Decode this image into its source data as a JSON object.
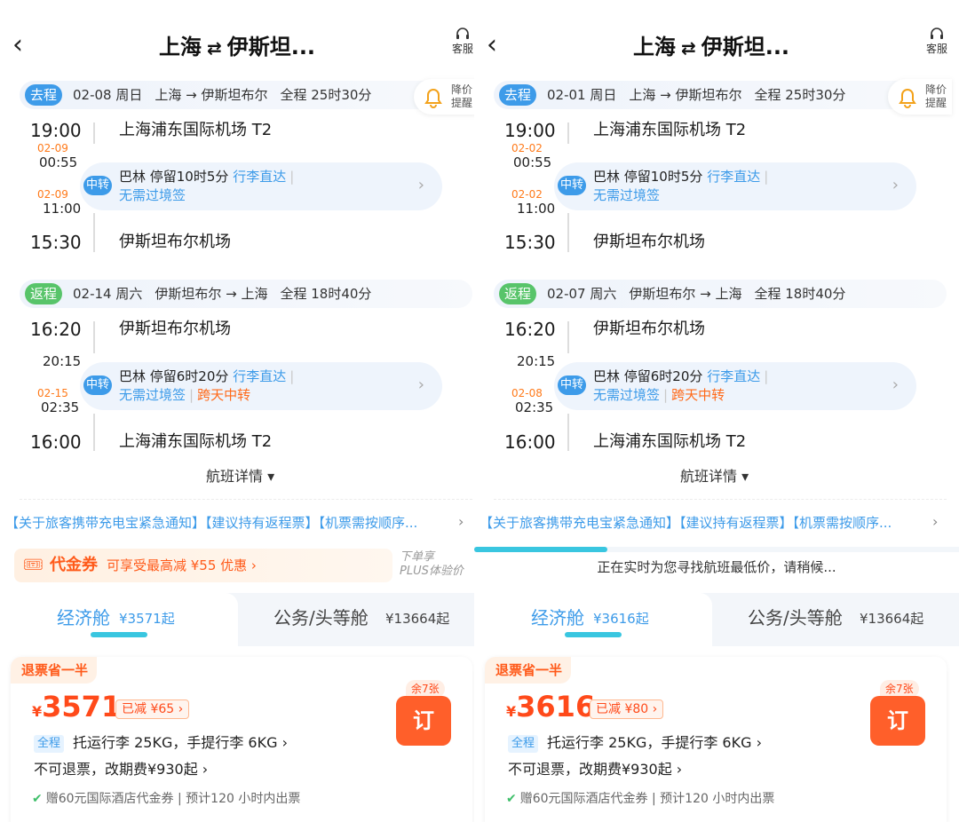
{
  "panels": [
    {
      "header": {
        "title_from": "上海",
        "title_to": "伊斯坦...",
        "service": "客服"
      },
      "price_alert": "降价\n提醒",
      "outbound": {
        "tag": "去程",
        "date": "02-08 周日",
        "route": "上海 → 伊斯坦布尔",
        "duration": "全程 25时30分",
        "dep_time": "19:00",
        "dep_airport": "上海浦东国际机场 T2",
        "stop_arr_date": "02-09",
        "stop_arr": "00:55",
        "stop_dep_date": "02-09",
        "stop_dep": "11:00",
        "transfer": {
          "badge": "中转",
          "city_stay": "巴林  停留10时5分",
          "baggage": "行李直达",
          "visa": "无需过境签",
          "cross_day": ""
        },
        "arr_time": "15:30",
        "arr_airport": "伊斯坦布尔机场"
      },
      "return": {
        "tag": "返程",
        "date": "02-14 周六",
        "route": "伊斯坦布尔 → 上海",
        "duration": "全程 18时40分",
        "dep_time": "16:20",
        "dep_airport": "伊斯坦布尔机场",
        "stop_arr_date": "",
        "stop_arr": "20:15",
        "stop_dep_date": "02-15",
        "stop_dep": "02:35",
        "transfer": {
          "badge": "中转",
          "city_stay": "巴林  停留6时20分",
          "baggage": "行李直达",
          "visa": "无需过境签",
          "cross_day": "跨天中转"
        },
        "arr_time": "16:00",
        "arr_airport": "上海浦东国际机场 T2"
      },
      "flight_details": "航班详情 ▾",
      "notice": "【关于旅客携带充电宝紧急通知】【建议持有返程票】【机票需按顺序...",
      "coupon": {
        "name": "代金券",
        "desc": "可享受最高减 ¥55 优惠  ›"
      },
      "plus_note": "下单享\nPLUS体验价",
      "loading_text": "",
      "cabins": {
        "economy": "经济舱",
        "economy_price": "¥3571起",
        "business": "公务/头等舱",
        "business_price": "¥13664起"
      },
      "offer": {
        "half_refund": "退票省一半",
        "currency": "¥",
        "price": "3571",
        "discount": "已减 ¥65 ›",
        "seats_left": "余7张",
        "book": "订",
        "full_tag": "全程",
        "baggage": "托运行李 25KG，手提行李 6KG ›",
        "refund_rule": "不可退票，改期费¥930起 ›",
        "gift": "赠60元国际酒店代金券 | 预计120 小时内出票"
      }
    },
    {
      "header": {
        "title_from": "上海",
        "title_to": "伊斯坦...",
        "service": "客服"
      },
      "price_alert": "降价\n提醒",
      "outbound": {
        "tag": "去程",
        "date": "02-01 周日",
        "route": "上海 → 伊斯坦布尔",
        "duration": "全程 25时30分",
        "dep_time": "19:00",
        "dep_airport": "上海浦东国际机场 T2",
        "stop_arr_date": "02-02",
        "stop_arr": "00:55",
        "stop_dep_date": "02-02",
        "stop_dep": "11:00",
        "transfer": {
          "badge": "中转",
          "city_stay": "巴林  停留10时5分",
          "baggage": "行李直达",
          "visa": "无需过境签",
          "cross_day": ""
        },
        "arr_time": "15:30",
        "arr_airport": "伊斯坦布尔机场"
      },
      "return": {
        "tag": "返程",
        "date": "02-07 周六",
        "route": "伊斯坦布尔 → 上海",
        "duration": "全程 18时40分",
        "dep_time": "16:20",
        "dep_airport": "伊斯坦布尔机场",
        "stop_arr_date": "",
        "stop_arr": "20:15",
        "stop_dep_date": "02-08",
        "stop_dep": "02:35",
        "transfer": {
          "badge": "中转",
          "city_stay": "巴林  停留6时20分",
          "baggage": "行李直达",
          "visa": "无需过境签",
          "cross_day": "跨天中转"
        },
        "arr_time": "16:00",
        "arr_airport": "上海浦东国际机场 T2"
      },
      "flight_details": "航班详情 ▾",
      "notice": "【关于旅客携带充电宝紧急通知】【建议持有返程票】【机票需按顺序...",
      "coupon": null,
      "plus_note": "",
      "loading_text": "正在实时为您寻找航班最低价，请稍候...",
      "cabins": {
        "economy": "经济舱",
        "economy_price": "¥3616起",
        "business": "公务/头等舱",
        "business_price": "¥13664起"
      },
      "offer": {
        "half_refund": "退票省一半",
        "currency": "¥",
        "price": "3616",
        "discount": "已减 ¥80 ›",
        "seats_left": "余7张",
        "book": "订",
        "full_tag": "全程",
        "baggage": "托运行李 25KG，手提行李 6KG ›",
        "refund_rule": "不可退票，改期费¥930起 ›",
        "gift": "赠60元国际酒店代金券 | 预计120 小时内出票"
      }
    }
  ],
  "colors": {
    "accent_blue": "#3d9be9",
    "price_orange": "#ff4a1a",
    "return_green": "#58c46a"
  },
  "icons": [
    "back-arrow-icon",
    "swap-arrows-icon",
    "headset-icon",
    "bell-icon",
    "chevron-right-icon",
    "coupon-icon",
    "check-icon"
  ]
}
